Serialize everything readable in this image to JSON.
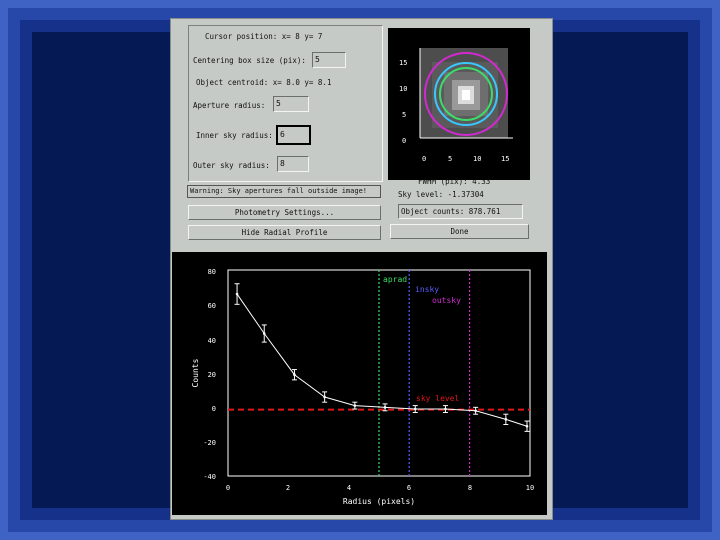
{
  "panel": {
    "cursor_position": "Cursor position:  x=   8  y=   7",
    "centering_box_label": "Centering box size (pix):",
    "centering_box_value": "5",
    "object_centroid": "Object centroid:  x=  8.0  y=  8.1",
    "aperture_label": "Aperture radius:",
    "aperture_value": "5",
    "inner_sky_label": "Inner sky radius:",
    "inner_sky_value": "6",
    "outer_sky_label": "Outer sky radius:",
    "outer_sky_value": "8"
  },
  "warning": "Warning: Sky apertures fall outside image!",
  "buttons": {
    "photometry_settings": "Photometry Settings...",
    "hide_radial_profile": "Hide Radial Profile",
    "done": "Done"
  },
  "stats": {
    "fwhm": "FWHM (pix):     4.33",
    "sky_level": "Sky level:   -1.37304",
    "object_counts": "Object counts: 878.761"
  },
  "image_axes": {
    "y_ticks": [
      "15",
      "10",
      "5",
      "0"
    ],
    "x_ticks": [
      "0",
      "5",
      "10",
      "15"
    ]
  },
  "profile_plot": {
    "xlabel": "Radius (pixels)",
    "ylabel": "Counts",
    "x_ticks": [
      "0",
      "2",
      "4",
      "6",
      "8",
      "10"
    ],
    "y_ticks": [
      "80",
      "60",
      "40",
      "20",
      "0",
      "-20",
      "-40"
    ],
    "marker_labels": {
      "aprad": "aprad",
      "insky": "insky",
      "outsky": "outsky",
      "sky_level": "sky level"
    },
    "colors": {
      "aprad": "#3ddc6a",
      "insky": "#5a5cff",
      "outsky": "#d02ad0",
      "sky": "#e01818",
      "data": "#ffffff"
    }
  },
  "chart_data": {
    "type": "line",
    "title": "",
    "xlabel": "Radius (pixels)",
    "ylabel": "Counts",
    "xlim": [
      0,
      10
    ],
    "ylim": [
      -40,
      80
    ],
    "series": [
      {
        "values": [
          [
            0.3,
            66
          ],
          [
            1.2,
            43
          ],
          [
            2.2,
            19
          ],
          [
            3.2,
            6
          ],
          [
            4.2,
            1
          ],
          [
            5.2,
            0
          ],
          [
            6.2,
            -1
          ],
          [
            7.2,
            -1
          ],
          [
            8.2,
            -2
          ],
          [
            9.2,
            -7
          ],
          [
            9.9,
            -11
          ]
        ]
      }
    ],
    "error_bars": [
      6,
      5,
      3,
      3,
      2,
      2,
      2,
      2,
      2,
      3,
      3
    ],
    "sky_level": -1.37,
    "aprad": 5,
    "insky": 6,
    "outsky": 8
  }
}
